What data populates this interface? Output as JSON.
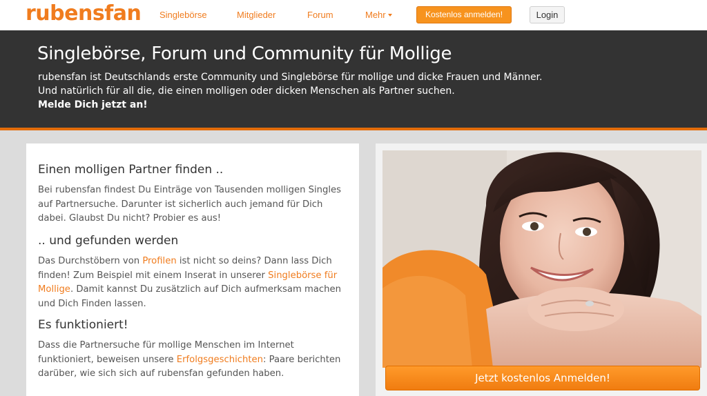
{
  "header": {
    "logo": "rubensfan",
    "nav": [
      {
        "label": "Singlebörse"
      },
      {
        "label": "Mitglieder"
      },
      {
        "label": "Forum"
      },
      {
        "label": "Mehr"
      }
    ],
    "register_label": "Kostenlos anmelden!",
    "login_label": "Login"
  },
  "hero": {
    "title": "Singlebörse, Forum und Community für Mollige",
    "line1": "rubensfan ist Deutschlands erste Community und Singlebörse für mollige und dicke Frauen und Männer.",
    "line2": "Und natürlich für all die, die einen molligen oder dicken Menschen als Partner suchen.",
    "cta": "Melde Dich jetzt an!"
  },
  "content": {
    "section1": {
      "heading": "Einen molligen Partner finden ..",
      "text": "Bei rubensfan findest Du Einträge von Tausenden molligen Singles auf Partnersuche. Darunter ist sicherlich auch jemand für Dich dabei. Glaubst Du nicht? Probier es aus!"
    },
    "section2": {
      "heading": ".. und gefunden werden",
      "text_a": "Das Durchstöbern von ",
      "link_a": "Profilen",
      "text_b": " ist nicht so deins? Dann lass Dich finden! Zum Beispiel mit einem Inserat in unserer ",
      "link_b": "Singlebörse für Mollige",
      "text_c": ". Damit kannst Du zusätzlich auf Dich aufmerksam machen und Dich Finden lassen."
    },
    "section3": {
      "heading": "Es funktioniert!",
      "text_a": "Dass die Partnersuche für mollige Menschen im Internet funktioniert, beweisen unsere ",
      "link_a": "Erfolgsgeschichten",
      "text_b": ": Paare berichten darüber, wie sich sich auf rubensfan gefunden haben."
    }
  },
  "image_panel": {
    "cta_label": "Jetzt kostenlos Anmelden!"
  },
  "colors": {
    "accent": "#f07c1e",
    "hero_bg": "#333333",
    "hero_border": "#e36c0a",
    "page_bg": "#dcdcdc"
  }
}
